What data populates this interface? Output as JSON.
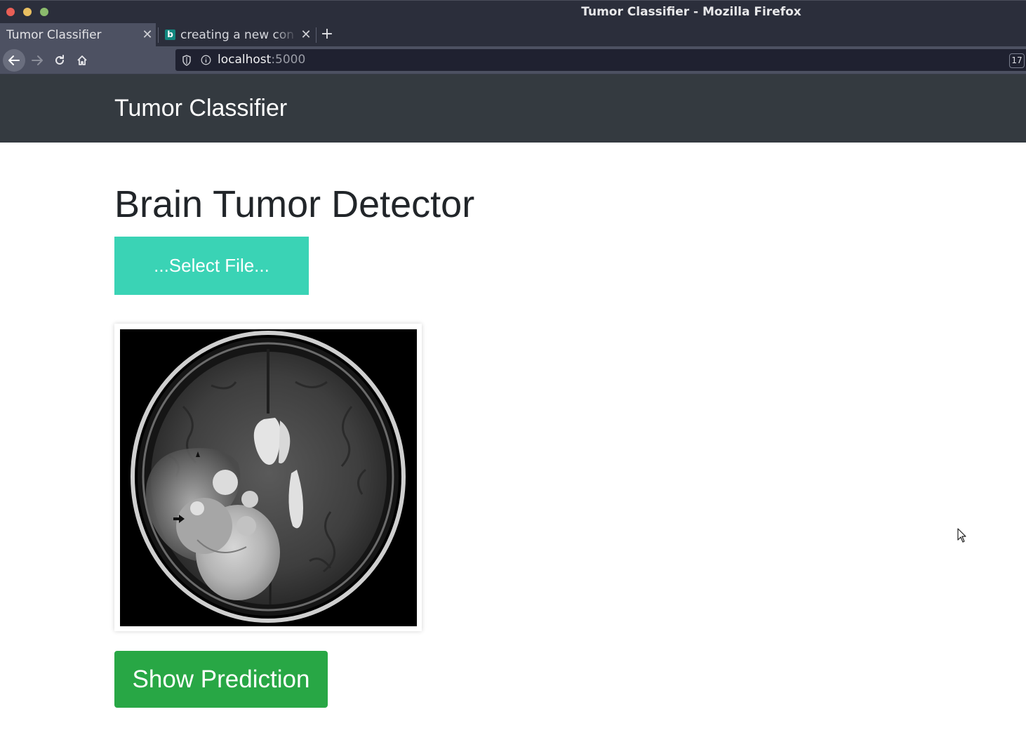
{
  "window": {
    "title": "Tumor Classifier - Mozilla Firefox",
    "controls": [
      "close",
      "minimize",
      "maximize"
    ],
    "control_colors": {
      "close": "#e95f56",
      "minimize": "#e9bf61",
      "maximize": "#8bbb6d"
    }
  },
  "tabs": [
    {
      "label": "Tumor Classifier",
      "active": true,
      "close_icon": "close-icon"
    },
    {
      "label": "creating a new con",
      "active": false,
      "favicon": "bing-icon",
      "favicon_letter": "b",
      "close_icon": "close-icon"
    }
  ],
  "newtab": {
    "icon": "+"
  },
  "address_bar": {
    "host": "localhost",
    "port": ":5000",
    "badge": "17"
  },
  "navbar": {
    "brand": "Tumor Classifier",
    "color": "#343a40"
  },
  "main": {
    "heading": "Brain Tumor Detector",
    "select_file_label": "...Select File...",
    "select_file_color": "#3ad3b5",
    "image_description": "axial MRI brain scan",
    "predict_label": "Show Prediction",
    "predict_color": "#28a745"
  }
}
